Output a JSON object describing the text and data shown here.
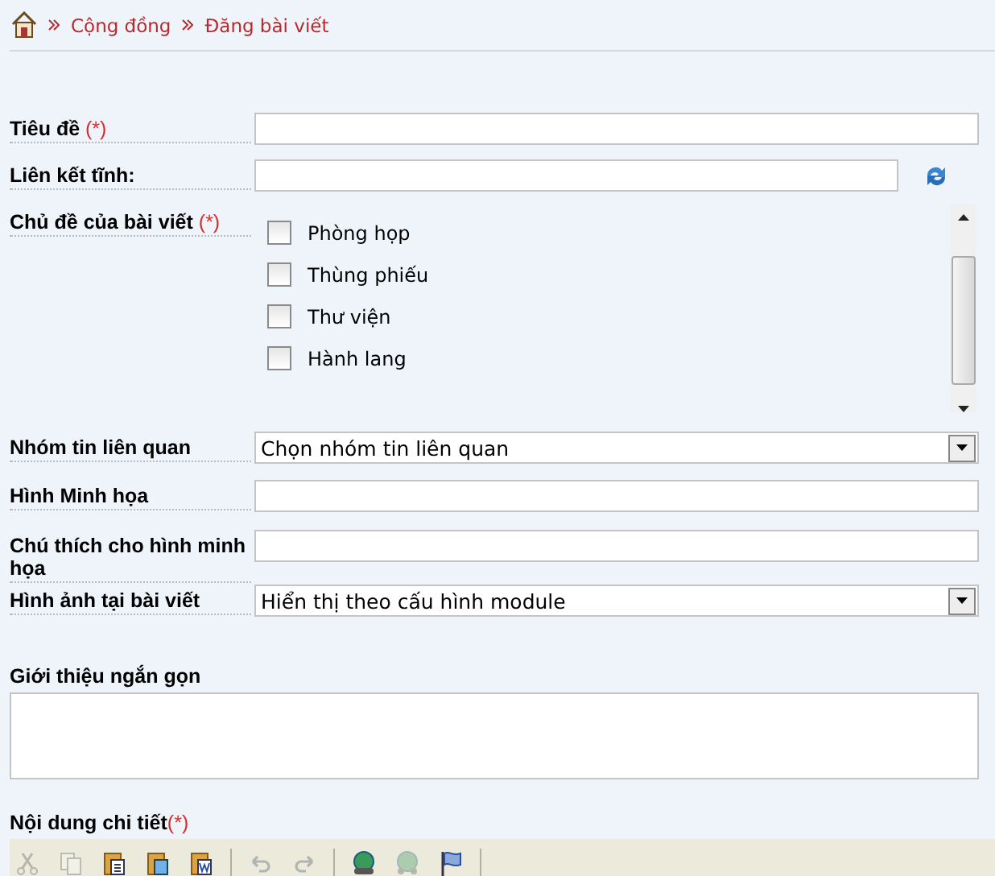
{
  "breadcrumb": [
    {
      "label": "Cộng đồng"
    },
    {
      "label": "Đăng bài viết"
    }
  ],
  "fields": [
    {
      "kind": "text",
      "label": "Tiêu đề",
      "mark": "(*)"
    },
    {
      "kind": "text",
      "label": "Liên kết tĩnh:",
      "refresh": true
    },
    {
      "kind": "checklist",
      "label": "Chủ đề của bài viết",
      "mark": "(*)",
      "options": [
        {
          "label": "Phòng họp",
          "checked": false
        },
        {
          "label": "Thùng phiếu",
          "checked": false
        },
        {
          "label": "Thư viện",
          "checked": false
        },
        {
          "label": "Hành lang",
          "checked": false
        }
      ]
    },
    {
      "kind": "select",
      "label": "Nhóm tin liên quan",
      "value": "Chọn nhóm tin liên quan"
    },
    {
      "kind": "text",
      "label": "Hình Minh họa"
    },
    {
      "kind": "text",
      "label": "Chú thích cho hình minh họa"
    },
    {
      "kind": "select",
      "label": "Hình ảnh tại bài viết",
      "value": "Hiển thị theo cấu hình module"
    }
  ],
  "summary": {
    "label": "Giới thiệu ngắn gọn"
  },
  "content": {
    "label": "Nội dung chi tiết",
    "mark": "(*)",
    "toolbar": [
      {
        "kind": "cut",
        "disabled": true
      },
      {
        "kind": "copy",
        "disabled": true
      },
      {
        "kind": "paste",
        "disabled": false
      },
      {
        "kind": "paste-text",
        "disabled": false
      },
      {
        "kind": "paste-word",
        "disabled": false
      },
      {
        "kind": "sep"
      },
      {
        "kind": "undo",
        "disabled": true
      },
      {
        "kind": "redo",
        "disabled": true
      },
      {
        "kind": "sep"
      },
      {
        "kind": "link",
        "disabled": false
      },
      {
        "kind": "unlink",
        "disabled": true
      },
      {
        "kind": "anchor",
        "disabled": false
      },
      {
        "kind": "sep"
      }
    ]
  }
}
